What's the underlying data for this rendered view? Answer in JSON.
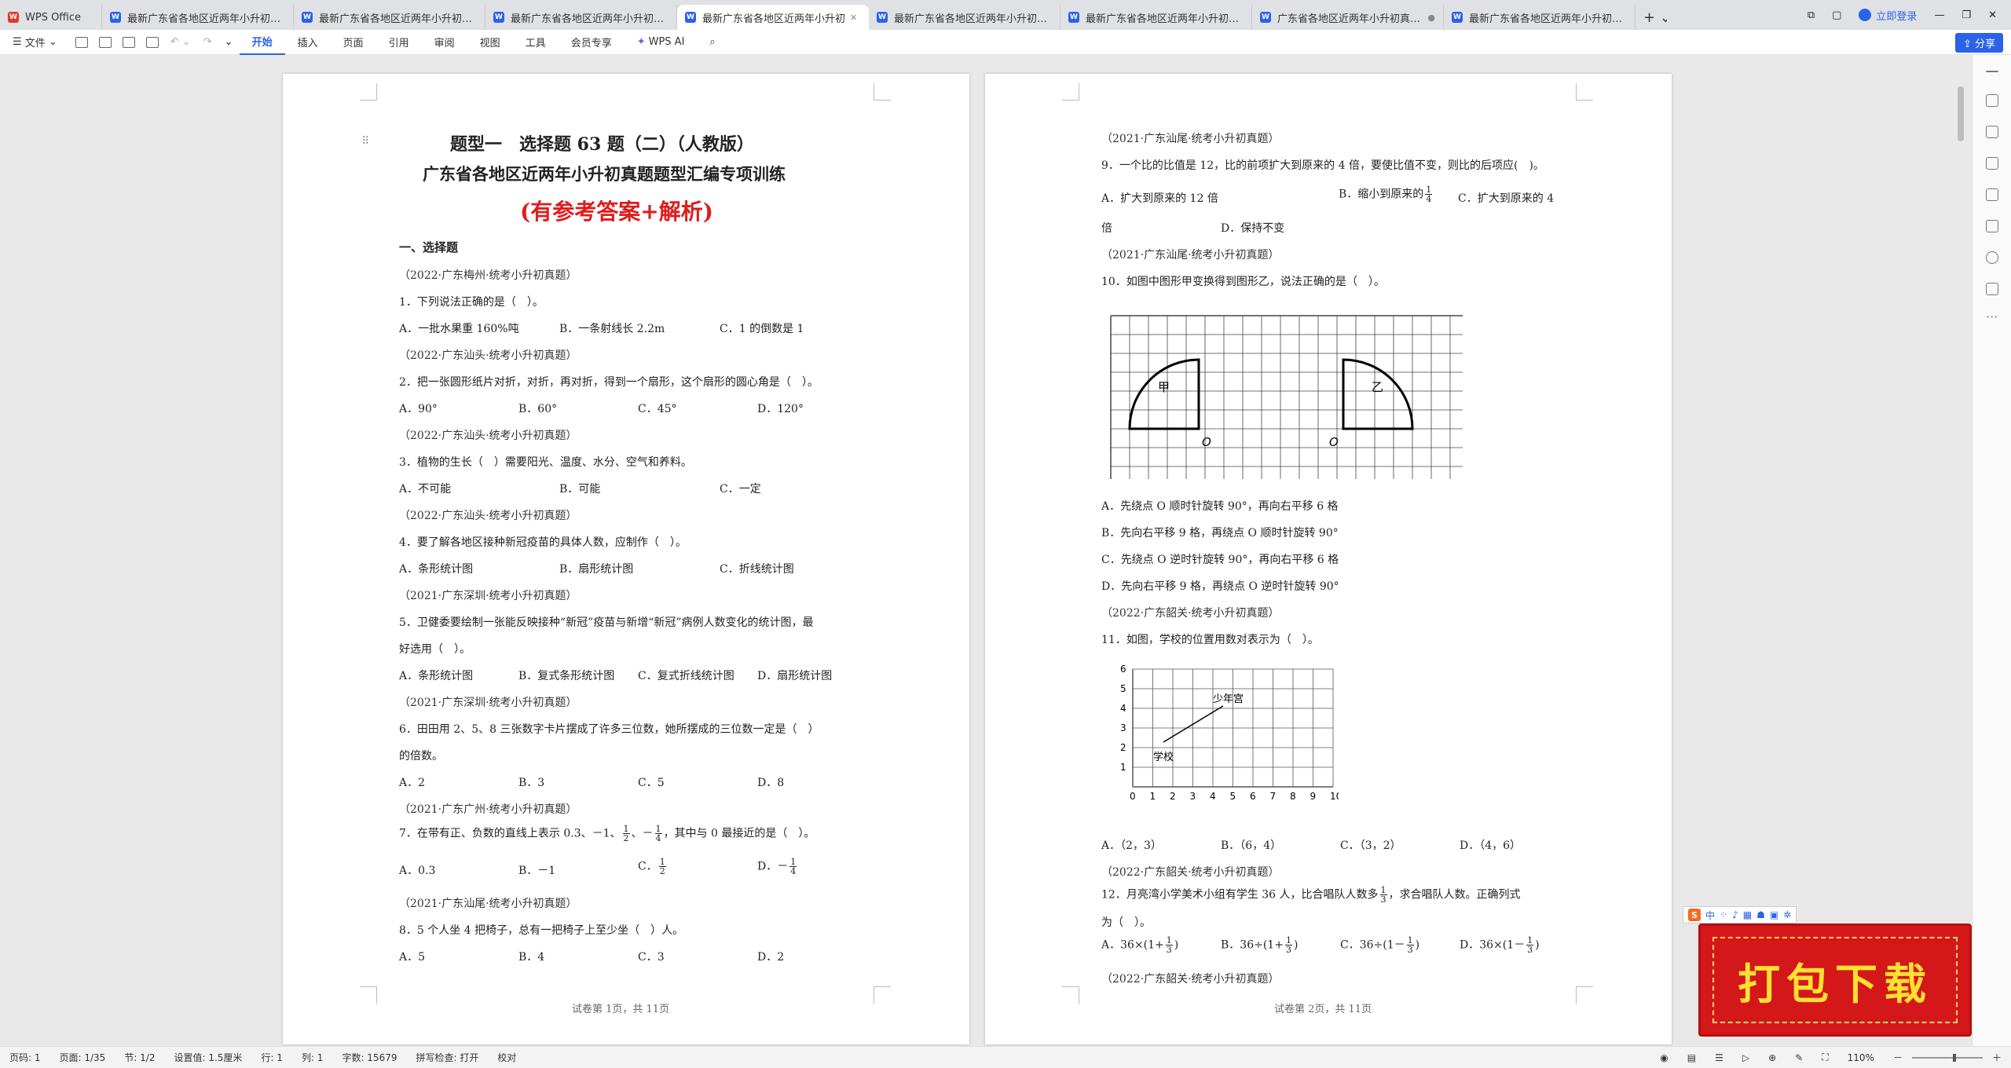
{
  "tabs": [
    {
      "label": "WPS Office",
      "icon": "wps-logo-icon"
    },
    {
      "label": "最新广东省各地区近两年小升初真题题"
    },
    {
      "label": "最新广东省各地区近两年小升初真题题"
    },
    {
      "label": "最新广东省各地区近两年小升初真题题"
    },
    {
      "label": "最新广东省各地区近两年小升初"
    },
    {
      "label": "最新广东省各地区近两年小升初真题题"
    },
    {
      "label": "最新广东省各地区近两年小升初真题题"
    },
    {
      "label": "广东省各地区近两年小升初真题题"
    },
    {
      "label": "最新广东省各地区近两年小升初真题题"
    }
  ],
  "login_label": "立即登录",
  "ribbon": {
    "file": "文件",
    "items": [
      "开始",
      "插入",
      "页面",
      "引用",
      "审阅",
      "视图",
      "工具",
      "会员专享"
    ],
    "ai": "WPS AI",
    "share": "分享"
  },
  "page1": {
    "title": "题型一　选择题 63 题（二）（人教版）",
    "subtitle": "广东省各地区近两年小升初真题题型汇编专项训练",
    "red": "(有参考答案+解析)",
    "section": "一、选择题",
    "lines": [
      "（2022·广东梅州·统考小升初真题）",
      "1．下列说法正确的是（　）。",
      "（2022·广东汕头·统考小升初真题）",
      "2．把一张圆形纸片对折，对折，再对折，得到一个扇形，这个扇形的圆心角是（　）。",
      "（2022·广东汕头·统考小升初真题）",
      "3．植物的生长（　）需要阳光、温度、水分、空气和养料。",
      "（2022·广东汕头·统考小升初真题）",
      "4．要了解各地区接种新冠疫苗的具体人数，应制作（　）。",
      "（2021·广东深圳·统考小升初真题）",
      "5．卫健委要绘制一张能反映接种“新冠”疫苗与新增“新冠”病例人数变化的统计图，最",
      "好选用（　）。",
      "（2021·广东深圳·统考小升初真题）",
      "6．田田用 2、5、8 三张数字卡片摆成了许多三位数，她所摆成的三位数一定是（　）",
      "的倍数。",
      "（2021·广东广州·统考小升初真题）",
      "（2021·广东汕尾·统考小升初真题）",
      "8．5 个人坐 4 把椅子，总有一把椅子上至少坐（　）人。"
    ],
    "q7": {
      "pre": "7．在带有正、负数的直线上表示 0.3、－1、",
      "mid": "、－",
      "post": "，其中与 0 最接近的是（　）。",
      "f1n": "1",
      "f1d": "2",
      "f2n": "1",
      "f2d": "4"
    },
    "opts": {
      "q1": [
        "A．一批水果重 160%吨",
        "B．一条射线长 2.2m",
        "C．1 的倒数是 1"
      ],
      "q2": [
        "A．90°",
        "B．60°",
        "C．45°",
        "D．120°"
      ],
      "q3": [
        "A．不可能",
        "B．可能",
        "C．一定"
      ],
      "q4": [
        "A．条形统计图",
        "B．扇形统计图",
        "C．折线统计图"
      ],
      "q5": [
        "A．条形统计图",
        "B．复式条形统计图",
        "C．复式折线统计图",
        "D．扇形统计图"
      ],
      "q6": [
        "A．2",
        "B．3",
        "C．5",
        "D．8"
      ],
      "q7": [
        "A．0.3",
        "B．－1",
        "C．",
        "D．－"
      ],
      "q8": [
        "A．5",
        "B．4",
        "C．3",
        "D．2"
      ]
    },
    "footer": "试卷第 1页，共 11页"
  },
  "page2": {
    "lines": [
      "（2021·广东汕尾·统考小升初真题）",
      "9．一个比的比值是 12，比的前项扩大到原来的 4 倍，要使比值不变，则比的后项应(　)。",
      "倍",
      "（2021·广东汕尾·统考小升初真题）",
      "10．如图中图形甲变换得到图形乙，说法正确的是（　）。",
      "A．先绕点 O 顺时针旋转 90°，再向右平移 6 格",
      "B．先向右平移 9 格，再绕点 O 顺时针旋转 90°",
      "C．先绕点 O 逆时针旋转 90°，再向右平移 6 格",
      "D．先向右平移 9 格，再绕点 O 逆时针旋转 90°",
      "（2022·广东韶关·统考小升初真题）",
      "11．如图，学校的位置用数对表示为（　）。",
      "（2022·广东韶关·统考小升初真题）",
      "为（　）。",
      "（2022·广东韶关·统考小升初真题）"
    ],
    "q9opts": [
      "A．扩大到原来的 12 倍",
      "B．缩小到原来的",
      "C．扩大到原来的 4",
      "D．保持不变"
    ],
    "q11opts": [
      "A．（2，3）",
      "B．（6，4）",
      "C．（3，2）",
      "D．（4，6）"
    ],
    "q12": {
      "pre": "12．月亮湾小学美术小组有学生 36 人，比合唱队人数多",
      "post": "，求合唱队人数。正确列式",
      "fn": "1",
      "fd": "3"
    },
    "q12opts": [
      "A．36×(1+",
      "B．36÷(1+",
      "C．36÷(1－",
      "D．36×(1－"
    ],
    "fig10": {
      "label_jia": "甲",
      "label_yi": "乙",
      "origin": "O"
    },
    "fig11": {
      "xticks": [
        "0",
        "1",
        "2",
        "3",
        "4",
        "5",
        "6",
        "7",
        "8",
        "9",
        "10"
      ],
      "yticks": [
        "1",
        "2",
        "3",
        "4",
        "5",
        "6"
      ],
      "school": "学校",
      "palace": "少年宫"
    },
    "footer": "试卷第 2页，共 11页"
  },
  "ime": {
    "items": [
      "中",
      "⁘",
      "♪",
      "▦",
      "☗",
      "▣",
      "✲"
    ]
  },
  "banner": "打包下载",
  "status": [
    "页码: 1",
    "页面: 1/35",
    "节: 1/2",
    "设置值: 1.5厘米",
    "行: 1",
    "列: 1",
    "字数: 15679",
    "拼写检查: 打开",
    "校对"
  ],
  "zoom": "110%"
}
